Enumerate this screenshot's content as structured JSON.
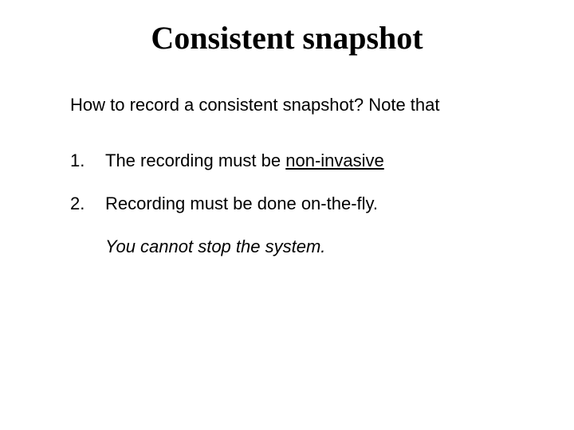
{
  "title": "Consistent snapshot",
  "intro": "How to record a consistent snapshot? Note that",
  "items": [
    {
      "num": "1.",
      "text_before": "The recording must be ",
      "underlined": "non-invasive",
      "text_after": ""
    },
    {
      "num": "2.",
      "text_before": "Recording must be done on-the-fly.",
      "underlined": "",
      "text_after": ""
    }
  ],
  "note": "You cannot stop the system."
}
